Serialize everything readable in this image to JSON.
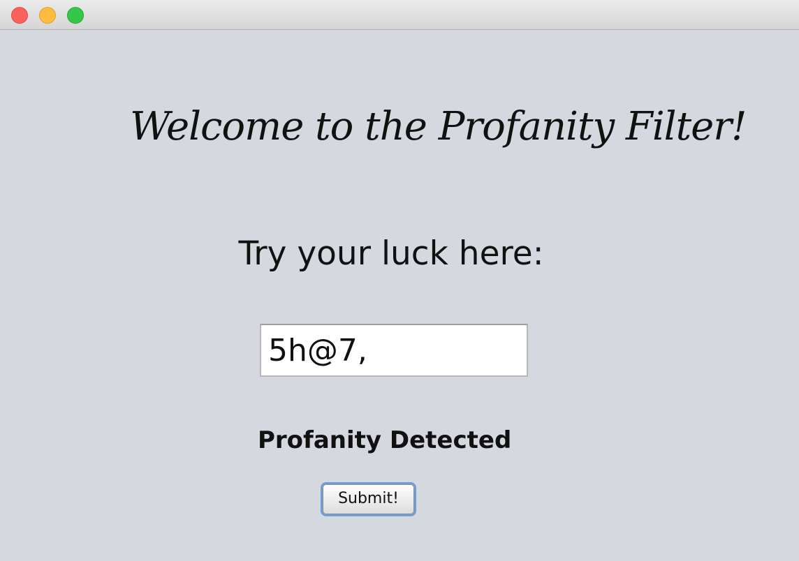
{
  "window": {
    "controls": {
      "close_icon": "close-icon",
      "minimize_icon": "minimize-icon",
      "zoom_icon": "zoom-icon",
      "colors": {
        "close": "#fc605c",
        "minimize": "#fdbc40",
        "zoom": "#34c84a"
      }
    },
    "background": "#d6d8e0"
  },
  "main": {
    "welcome_text": "Welcome to the Profanity Filter!",
    "prompt_text": "Try your luck here:",
    "input": {
      "value": "5h@7,",
      "placeholder": ""
    },
    "status_text": "Profanity Detected",
    "submit_label": "Submit!"
  }
}
